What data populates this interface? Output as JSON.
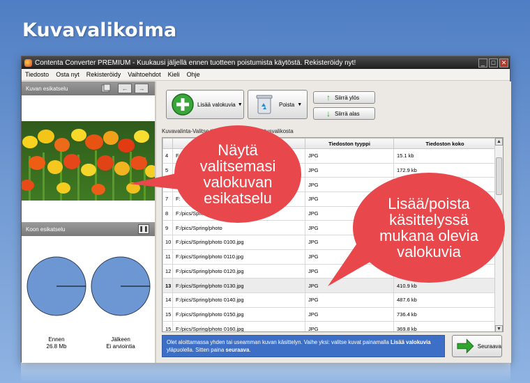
{
  "page": {
    "title": "Kuvavalikoima"
  },
  "window": {
    "title": "Contenta Converter PREMIUM  - Kuukausi jäljellä ennen tuotteen poistumista käytöstä. Rekisteröidy nyt!",
    "controls": {
      "minimize": "_",
      "maximize": "□",
      "close": "✕"
    }
  },
  "menu": [
    "Tiedosto",
    "Osta nyt",
    "Rekisteröidy",
    "Vaihtoehdot",
    "Kieli",
    "Ohje"
  ],
  "left": {
    "preview_header": "Kuvan esikatselu",
    "size_header": "Koon esikatselu",
    "before_label": "Ennen",
    "before_value": "26.8 Mb",
    "after_label": "Jälkeen",
    "after_value": "Ei arviointia"
  },
  "toolbar": {
    "add_label": "Lisää valokuvia",
    "remove_label": "Poista",
    "move_up_label": "Siirrä ylös",
    "move_down_label": "Siirrä alas"
  },
  "table": {
    "section_label": "Kuvavalinta-Valitse ti",
    "section_label_tail": "dotusvalikosta",
    "columns": [
      "",
      "",
      "Tiedoston tyyppi",
      "Tiedoston koko"
    ],
    "rows": [
      {
        "num": "4",
        "path": "F:",
        "type": "JPG",
        "size": "15.1 kb"
      },
      {
        "num": "5",
        "path": "F:",
        "type": "JPG",
        "size": "172.9 kb"
      },
      {
        "num": "6",
        "path": "F:",
        "type": "JPG",
        "size": ""
      },
      {
        "num": "7",
        "path": "F:",
        "type": "JPG",
        "size": ""
      },
      {
        "num": "8",
        "path": "F:/pics/Spring/ph",
        "type": "JPG",
        "size": ""
      },
      {
        "num": "9",
        "path": "F:/pics/Spring/photo",
        "type": "JPG",
        "size": ""
      },
      {
        "num": "10",
        "path": "F:/pics/Spring/photo 0100.jpg",
        "type": "JPG",
        "size": ""
      },
      {
        "num": "11",
        "path": "F:/pics/Spring/photo 0110.jpg",
        "type": "JPG",
        "size": ""
      },
      {
        "num": "12",
        "path": "F:/pics/Spring/photo 0120.jpg",
        "type": "JPG",
        "size": ""
      },
      {
        "num": "13",
        "path": "F:/pics/Spring/photo 0130.jpg",
        "type": "JPG",
        "size": "410.9 kb"
      },
      {
        "num": "14",
        "path": "F:/pics/Spring/photo 0140.jpg",
        "type": "JPG",
        "size": "487.6 kb"
      },
      {
        "num": "15",
        "path": "F:/pics/Spring/photo 0150.jpg",
        "type": "JPG",
        "size": "736.4 kb"
      },
      {
        "num": "15",
        "path": "F:/pics/Spring/photo 0160.jpg",
        "type": "JPG",
        "size": "369.8 kb"
      }
    ],
    "selected_row": "13"
  },
  "info": {
    "text_1": "Olet aloittamassa yhden tai useamman kuvan käsittelyn. Vaihe yksi: valitse kuvat painamalla ",
    "bold_1": "Lisää valokuvia",
    "text_2": " yläpuolella. Sitten paina ",
    "bold_2": "seuraava",
    "text_3": "."
  },
  "next_button": {
    "label": "Seuraava"
  },
  "callouts": {
    "preview": "Näytä valitsemasi valokuvan esikatselu",
    "addremove": "Lisää/poista käsittelyssä mukana olevia valokuvia"
  },
  "colors": {
    "background": "#6f98d2",
    "callout": "#e8484c",
    "info_box": "#3d6fc7",
    "pie": "#6d97d3"
  },
  "icons": [
    "add-icon",
    "recycle-bin-icon",
    "arrow-up-icon",
    "arrow-down-icon",
    "next-arrow-icon",
    "pause-icon",
    "rotate-icon",
    "arrow-left-icon",
    "arrow-right-icon"
  ]
}
